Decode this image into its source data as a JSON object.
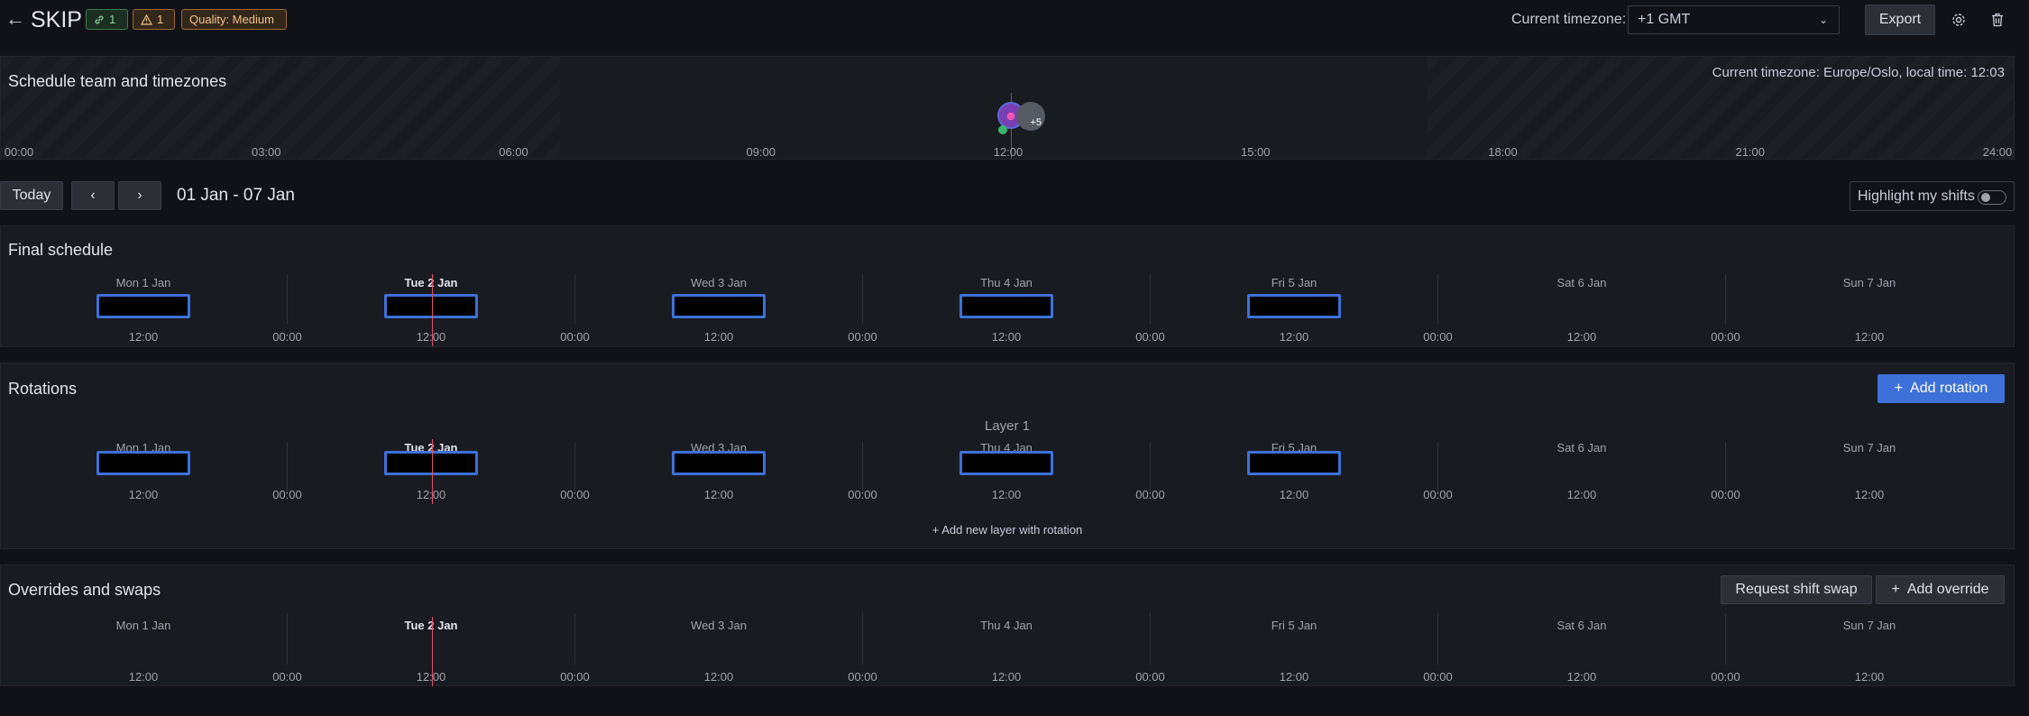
{
  "header": {
    "title": "SKIP",
    "badges": {
      "links": "1",
      "warnings": "1",
      "quality": "Quality: Medium"
    },
    "timezone_label": "Current timezone:",
    "timezone_value": "+1 GMT",
    "export_label": "Export"
  },
  "team": {
    "title": "Schedule team and timezones",
    "timezone_info": "Current timezone: Europe/Oslo, local time: 12:03",
    "hours": [
      "00:00",
      "03:00",
      "06:00",
      "09:00",
      "12:00",
      "15:00",
      "18:00",
      "21:00",
      "24:00"
    ],
    "extra_count": "+5"
  },
  "toolbar": {
    "today_label": "Today",
    "prev_label": "‹",
    "next_label": "›",
    "date_range": "01 Jan - 07 Jan",
    "highlight_label": "Highlight my shifts"
  },
  "days": [
    "Mon 1 Jan",
    "Tue 2 Jan",
    "Wed 3 Jan",
    "Thu 4 Jan",
    "Fri 5 Jan",
    "Sat 6 Jan",
    "Sun 7 Jan"
  ],
  "ticks": [
    "12:00",
    "00:00",
    "12:00",
    "00:00",
    "12:00",
    "00:00",
    "12:00",
    "00:00",
    "12:00",
    "00:00",
    "12:00",
    "00:00",
    "12:00"
  ],
  "final": {
    "title": "Final schedule"
  },
  "rotations": {
    "title": "Rotations",
    "add_label": "Add rotation",
    "layer_label": "Layer 1",
    "add_layer_label": "+ Add new layer with rotation"
  },
  "overrides": {
    "title": "Overrides and swaps",
    "swap_label": "Request shift swap",
    "override_label": "Add override"
  },
  "colors": {
    "accent": "#3d71d9",
    "now_line": "#e0526b",
    "background": "#111217",
    "panel": "#181b1f"
  }
}
